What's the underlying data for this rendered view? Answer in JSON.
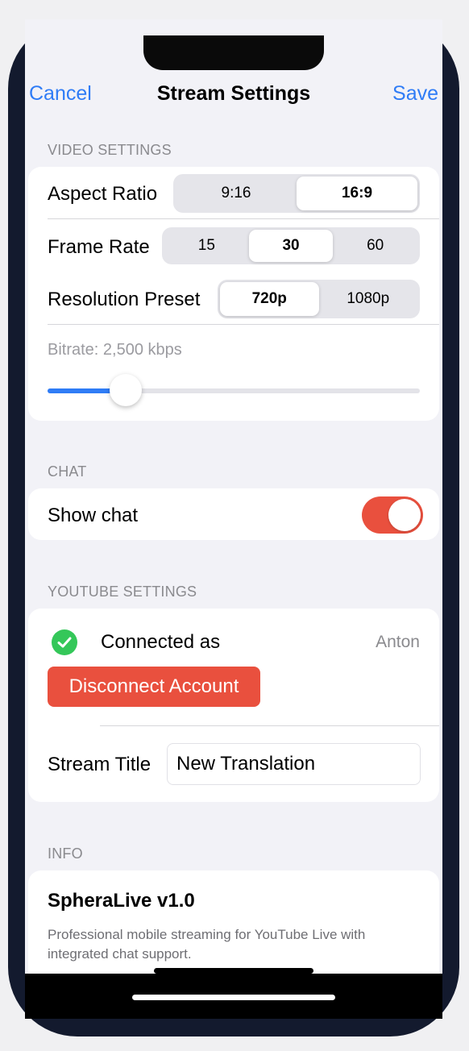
{
  "nav": {
    "cancel_label": "Cancel",
    "title": "Stream Settings",
    "save_label": "Save"
  },
  "video_settings": {
    "header": "VIDEO SETTINGS",
    "aspect_ratio": {
      "label": "Aspect Ratio",
      "options": [
        "9:16",
        "16:9"
      ],
      "selected": "16:9"
    },
    "frame_rate": {
      "label": "Frame Rate",
      "options": [
        "15",
        "30",
        "60"
      ],
      "selected": "30"
    },
    "resolution": {
      "label": "Resolution Preset",
      "options": [
        "720p",
        "1080p"
      ],
      "selected": "720p"
    },
    "bitrate": {
      "label": "Bitrate: 2,500 kbps",
      "slider_fraction": 0.21
    }
  },
  "chat": {
    "header": "CHAT",
    "show_chat_label": "Show chat",
    "show_chat_enabled": true
  },
  "youtube": {
    "header": "YOUTUBE SETTINGS",
    "connected_label": "Connected as",
    "connected_user": "Anton",
    "disconnect_label": "Disconnect Account",
    "stream_title_label": "Stream Title",
    "stream_title_value": "New Translation"
  },
  "info": {
    "header": "INFO",
    "app_name": "SpheraLive v1.0",
    "description": "Professional mobile streaming for YouTube Live with integrated chat support."
  },
  "colors": {
    "accent": "#2f7cf6",
    "destructive": "#e9503e",
    "success": "#34c759"
  }
}
